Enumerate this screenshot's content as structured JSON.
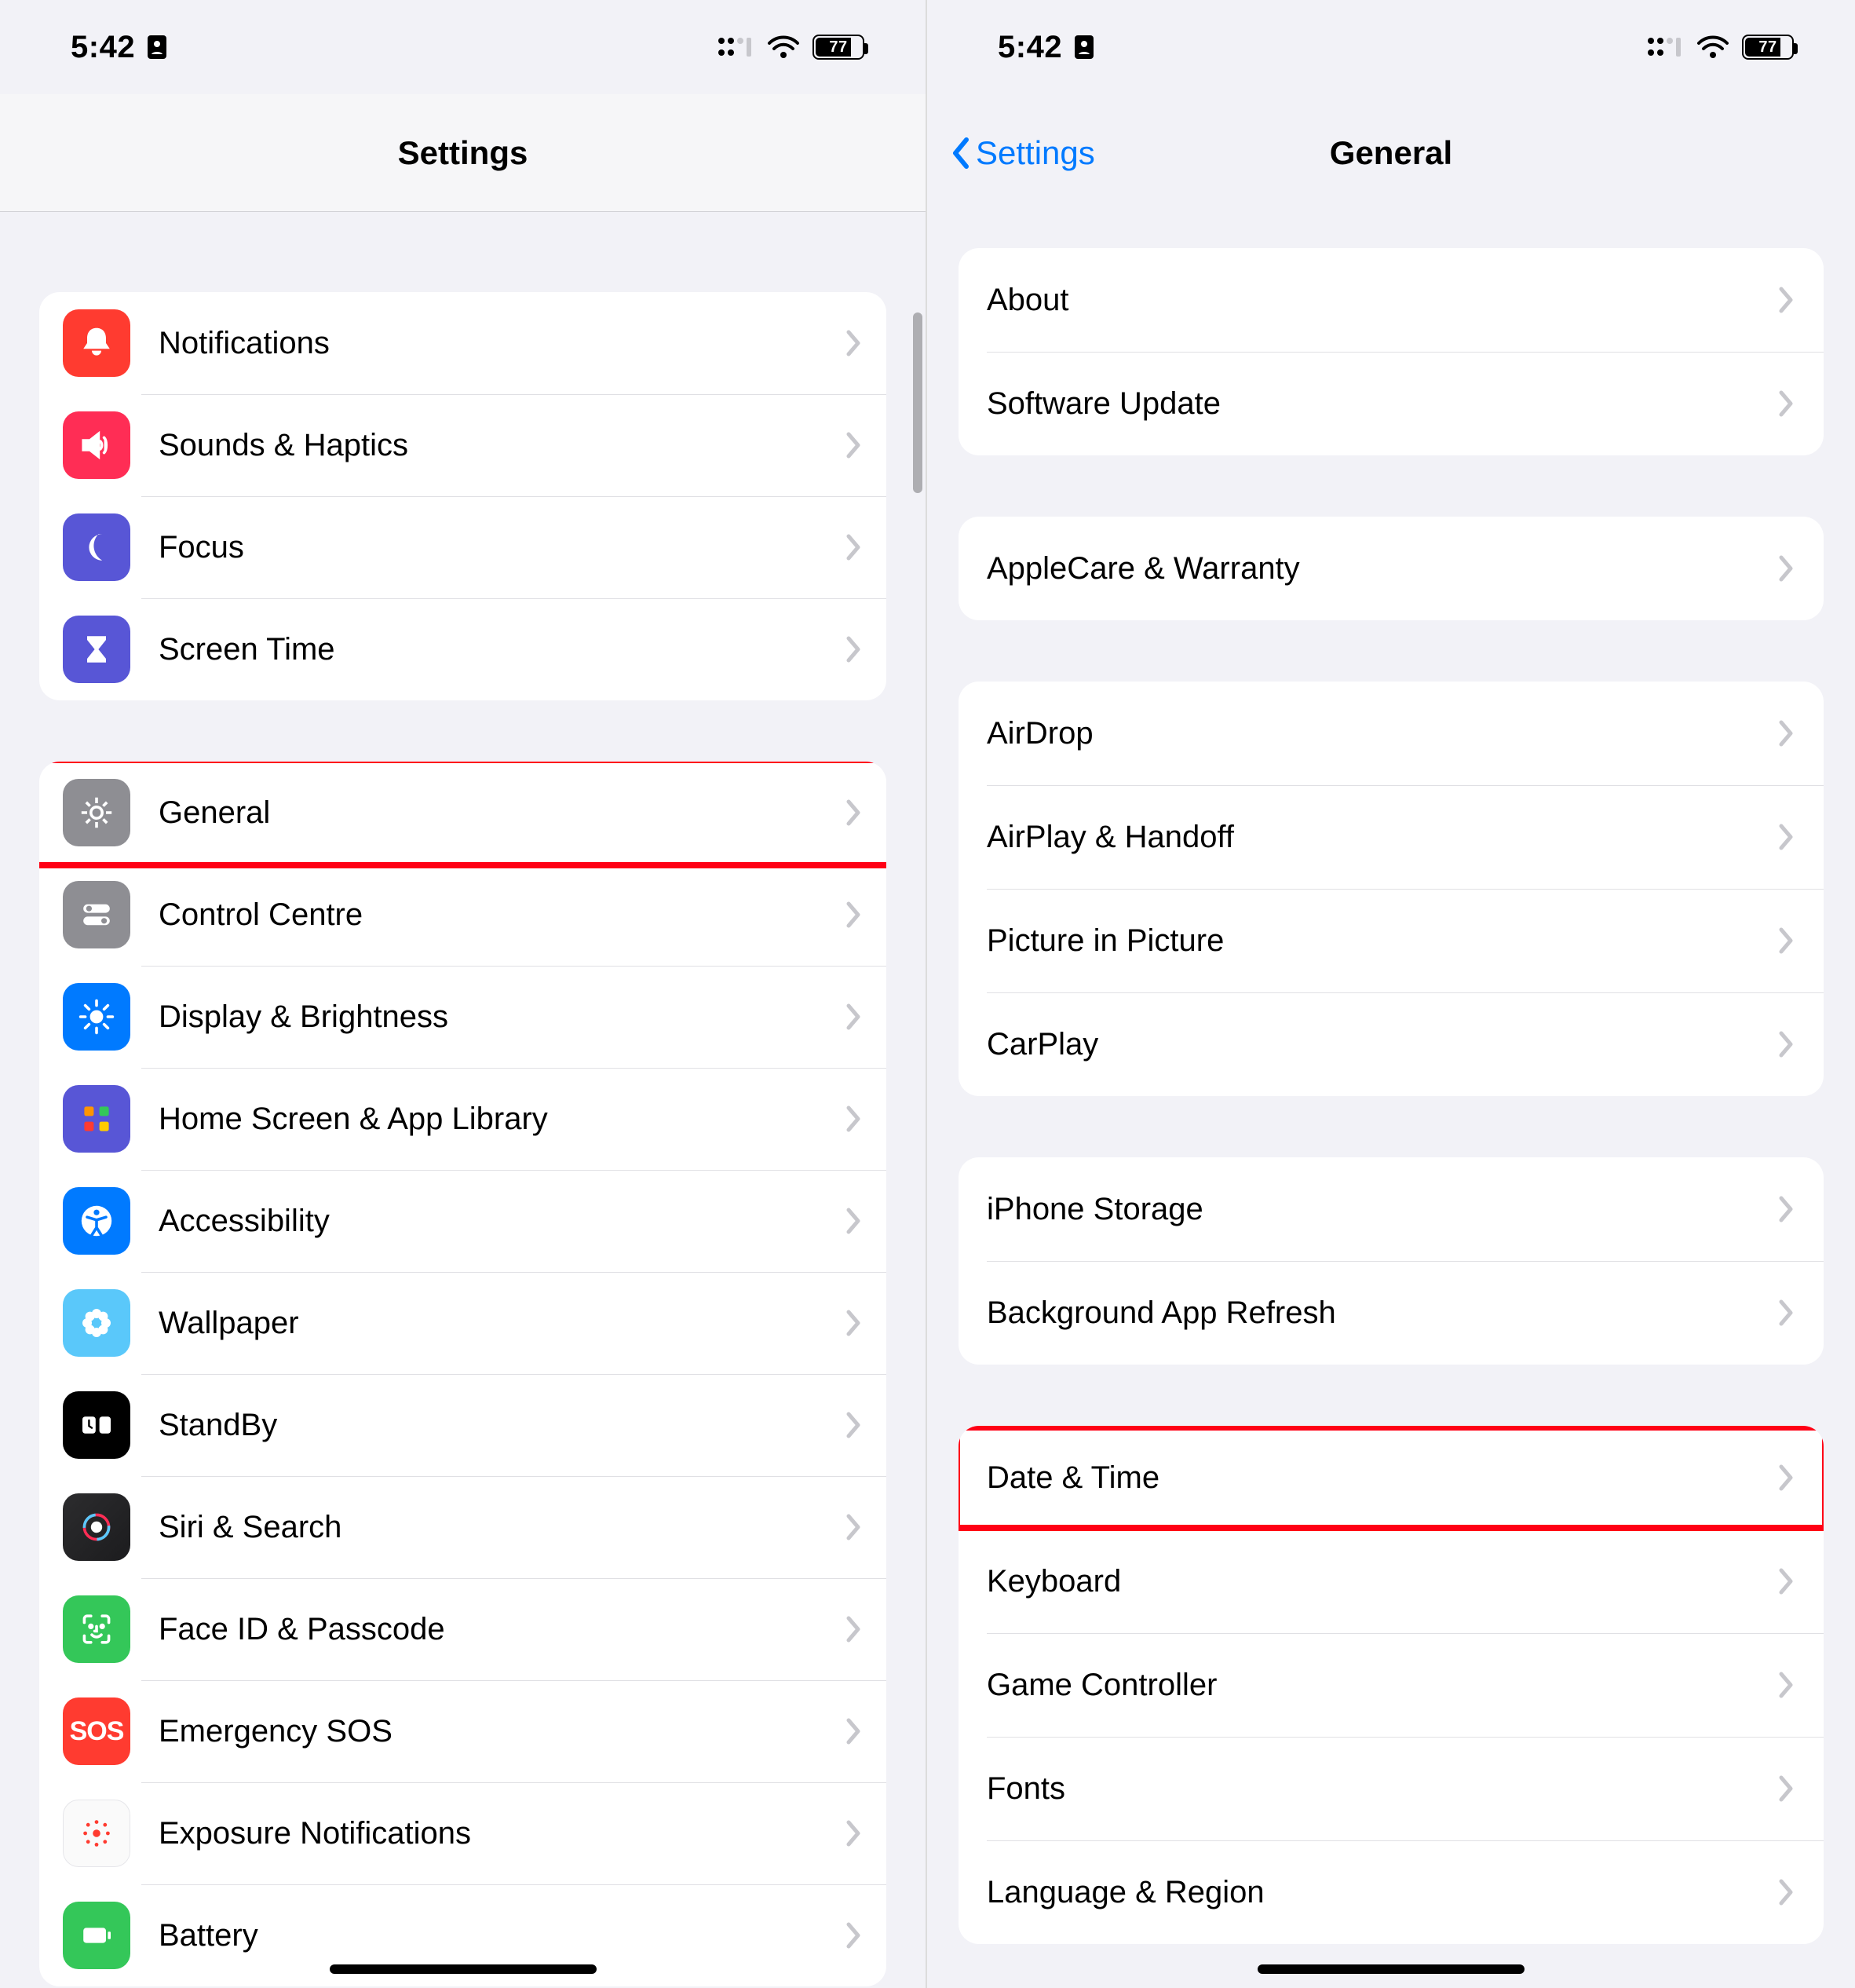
{
  "status": {
    "time": "5:42",
    "battery_pct": "77"
  },
  "left": {
    "title": "Settings",
    "sections": [
      {
        "rows": [
          {
            "id": "notifications",
            "label": "Notifications",
            "icon": "bell-icon",
            "bg": "bg-red"
          },
          {
            "id": "sounds-haptics",
            "label": "Sounds & Haptics",
            "icon": "speaker-icon",
            "bg": "bg-pink"
          },
          {
            "id": "focus",
            "label": "Focus",
            "icon": "moon-icon",
            "bg": "bg-purple"
          },
          {
            "id": "screen-time",
            "label": "Screen Time",
            "icon": "hourglass-icon",
            "bg": "bg-purple"
          }
        ]
      },
      {
        "rows": [
          {
            "id": "general",
            "label": "General",
            "icon": "gear-icon",
            "bg": "bg-gray",
            "highlight": true
          },
          {
            "id": "control-centre",
            "label": "Control Centre",
            "icon": "switches-icon",
            "bg": "bg-gray"
          },
          {
            "id": "display-brightness",
            "label": "Display & Brightness",
            "icon": "sun-icon",
            "bg": "bg-blue"
          },
          {
            "id": "home-screen",
            "label": "Home Screen & App Library",
            "icon": "grid-icon",
            "bg": "bg-purple"
          },
          {
            "id": "accessibility",
            "label": "Accessibility",
            "icon": "accessibility-icon",
            "bg": "bg-blue"
          },
          {
            "id": "wallpaper",
            "label": "Wallpaper",
            "icon": "flower-icon",
            "bg": "bg-cyan"
          },
          {
            "id": "standby",
            "label": "StandBy",
            "icon": "clock-widget-icon",
            "bg": "bg-black"
          },
          {
            "id": "siri-search",
            "label": "Siri & Search",
            "icon": "siri-icon",
            "bg": "bg-siri"
          },
          {
            "id": "face-id",
            "label": "Face ID & Passcode",
            "icon": "faceid-icon",
            "bg": "bg-green"
          },
          {
            "id": "emergency-sos",
            "label": "Emergency SOS",
            "icon": "sos-icon",
            "bg": "bg-red"
          },
          {
            "id": "exposure-notifications",
            "label": "Exposure Notifications",
            "icon": "exposure-icon",
            "bg": "bg-white"
          },
          {
            "id": "battery",
            "label": "Battery",
            "icon": "battery-icon",
            "bg": "bg-green"
          }
        ]
      }
    ]
  },
  "right": {
    "back_label": "Settings",
    "title": "General",
    "sections": [
      {
        "rows": [
          {
            "id": "about",
            "label": "About"
          },
          {
            "id": "software-update",
            "label": "Software Update"
          }
        ]
      },
      {
        "rows": [
          {
            "id": "applecare",
            "label": "AppleCare & Warranty"
          }
        ]
      },
      {
        "rows": [
          {
            "id": "airdrop",
            "label": "AirDrop"
          },
          {
            "id": "airplay-handoff",
            "label": "AirPlay & Handoff"
          },
          {
            "id": "picture-in-picture",
            "label": "Picture in Picture"
          },
          {
            "id": "carplay",
            "label": "CarPlay"
          }
        ]
      },
      {
        "rows": [
          {
            "id": "iphone-storage",
            "label": "iPhone Storage"
          },
          {
            "id": "background-app-refresh",
            "label": "Background App Refresh"
          }
        ]
      },
      {
        "rows": [
          {
            "id": "date-time",
            "label": "Date & Time",
            "highlight": true
          },
          {
            "id": "keyboard",
            "label": "Keyboard"
          },
          {
            "id": "game-controller",
            "label": "Game Controller"
          },
          {
            "id": "fonts",
            "label": "Fonts"
          },
          {
            "id": "language-region",
            "label": "Language & Region"
          }
        ]
      }
    ]
  }
}
